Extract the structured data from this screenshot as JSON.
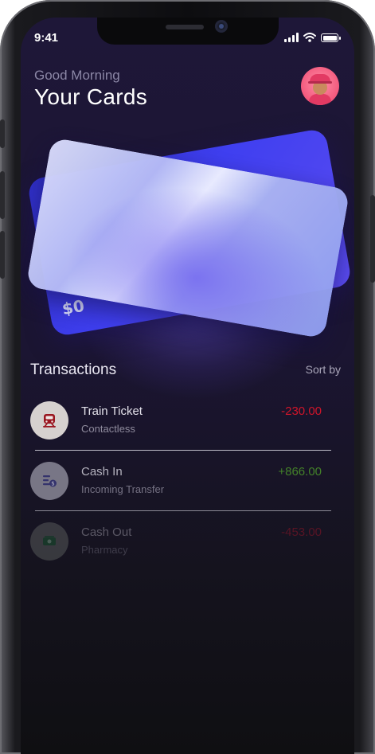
{
  "status_bar": {
    "time": "9:41"
  },
  "header": {
    "greeting": "Good Morning",
    "title": "Your Cards"
  },
  "card_back": {
    "partial_text": "$0"
  },
  "transactions": {
    "title": "Transactions",
    "sort_label": "Sort by",
    "items": [
      {
        "name": "Train Ticket",
        "sub": "Contactless",
        "amount": "-230.00",
        "icon": "train-icon"
      },
      {
        "name": "Cash In",
        "sub": "Incoming Transfer",
        "amount": "+866.00",
        "icon": "transfer-icon"
      },
      {
        "name": "Cash Out",
        "sub": "Pharmacy",
        "amount": "-453.00",
        "icon": "cash-icon"
      }
    ]
  },
  "colors": {
    "negative": "#d0152a",
    "positive": "#4d9a2a",
    "card_blue": "#3f3ff0",
    "avatar_pink": "#f2587c"
  }
}
